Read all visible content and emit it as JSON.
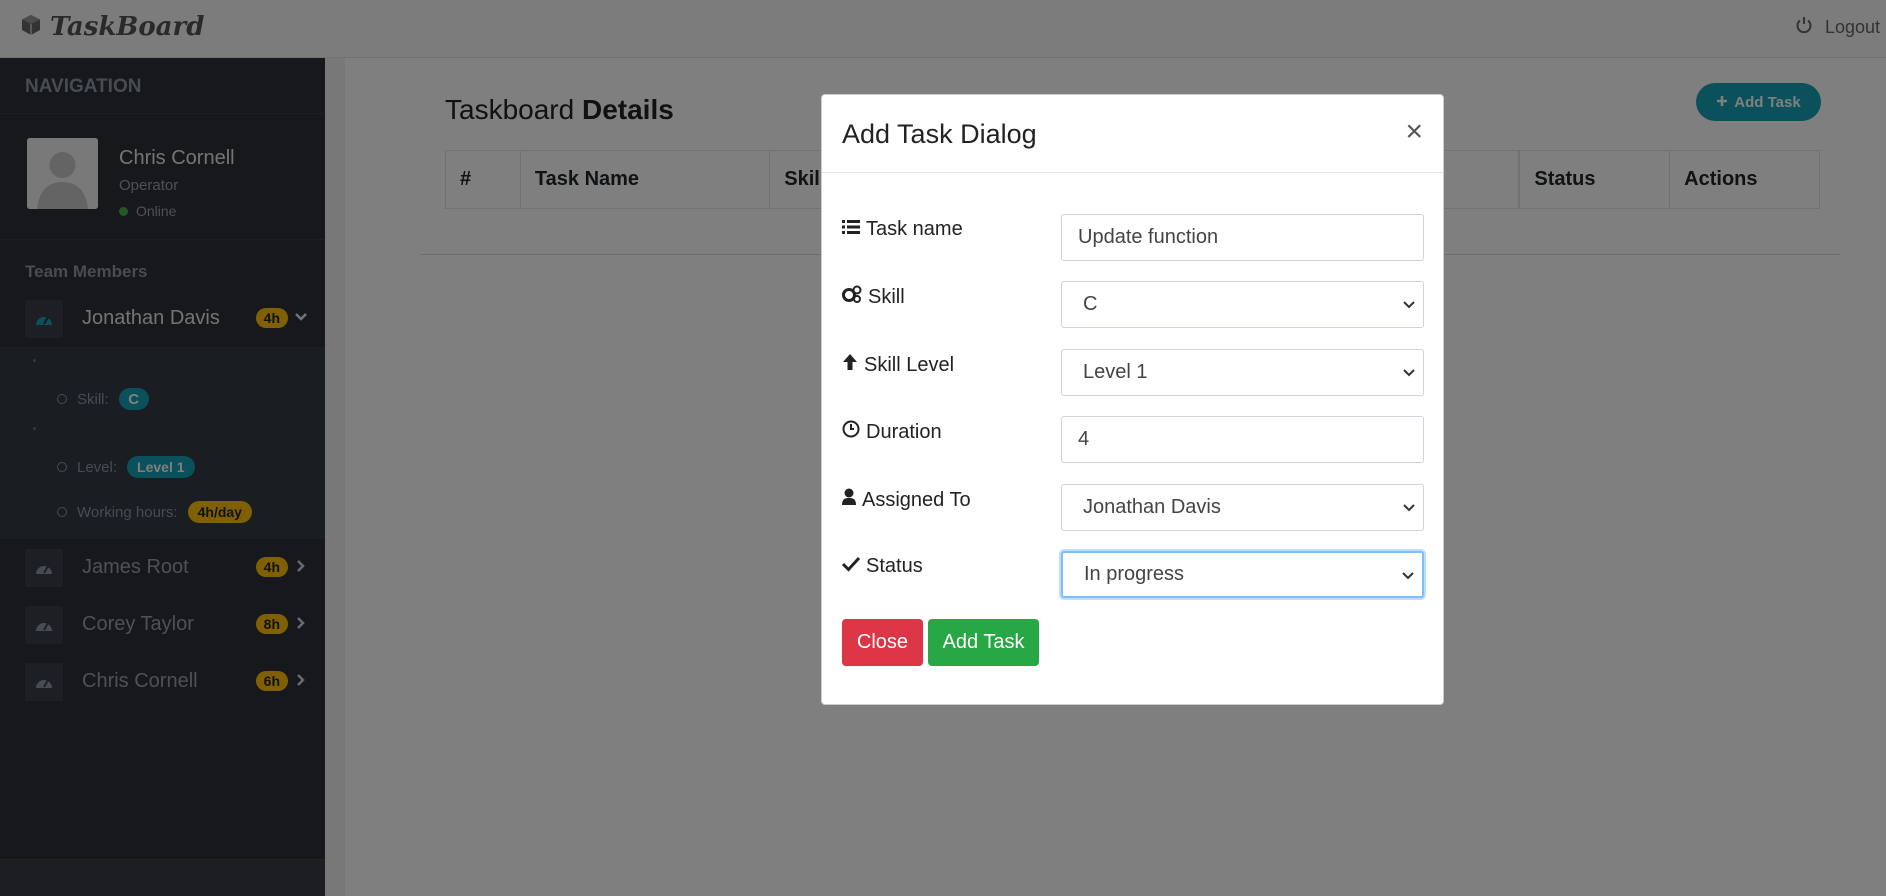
{
  "brand": {
    "name": "TaskBoard",
    "icon": "cube-icon"
  },
  "topbar": {
    "logout_label": "Logout",
    "logout_icon": "power-icon"
  },
  "sidebar": {
    "nav_header": "NAVIGATION",
    "user": {
      "name": "Chris Cornell",
      "role": "Operator",
      "status": "Online"
    },
    "team_header": "Team Members",
    "members": [
      {
        "name": "Jonathan Davis",
        "hours": "4h",
        "expanded": true,
        "details": {
          "skill_label": "Skill:",
          "skill_value": "C",
          "level_label": "Level:",
          "level_value": "Level 1",
          "working_label": "Working hours:",
          "working_value": "4h/day"
        }
      },
      {
        "name": "James Root",
        "hours": "4h"
      },
      {
        "name": "Corey Taylor",
        "hours": "8h"
      },
      {
        "name": "Chris Cornell",
        "hours": "6h"
      }
    ]
  },
  "main": {
    "title_prefix": "Taskboard",
    "title_bold": "Details",
    "add_task_label": "Add Task",
    "table_headers": [
      "#",
      "Task Name",
      "Skill",
      "",
      "Status",
      "Actions"
    ]
  },
  "modal": {
    "title": "Add Task Dialog",
    "close_symbol": "×",
    "fields": {
      "task_name": {
        "label": "Task name",
        "value": "Update function"
      },
      "skill": {
        "label": "Skill",
        "value": "C"
      },
      "skill_level": {
        "label": "Skill Level",
        "value": "Level 1"
      },
      "duration": {
        "label": "Duration",
        "value": "4"
      },
      "assigned_to": {
        "label": "Assigned To",
        "value": "Jonathan Davis"
      },
      "status": {
        "label": "Status",
        "value": "In progress"
      }
    },
    "close_label": "Close",
    "add_label": "Add Task"
  },
  "colors": {
    "accent": "#17a2b8",
    "warning": "#ffc107",
    "danger": "#dc3545",
    "success": "#28a745",
    "sidebar": "#2c3038"
  }
}
